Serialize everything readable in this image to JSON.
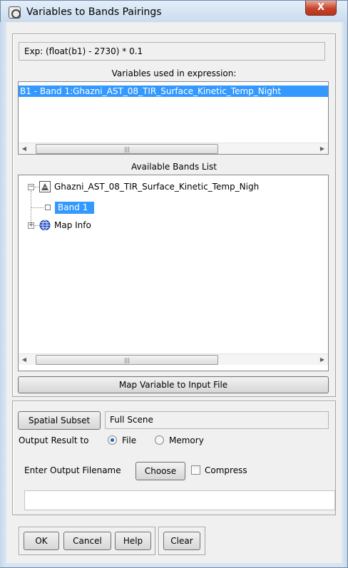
{
  "window": {
    "title": "Variables to Bands Pairings",
    "close_glyph": "X"
  },
  "expression": {
    "label": "Exp:",
    "value": "(float(b1) - 2730) * 0.1"
  },
  "variables": {
    "heading": "Variables used in expression:",
    "items": [
      "B1 - Band 1:Ghazni_AST_08_TIR_Surface_Kinetic_Temp_Night"
    ]
  },
  "bands": {
    "heading": "Available Bands List",
    "file_node": "Ghazni_AST_08_TIR_Surface_Kinetic_Temp_Nigh",
    "band_node": "Band 1",
    "mapinfo_node": "Map Info"
  },
  "map_button_label": "Map Variable to Input File",
  "spatial": {
    "button_label": "Spatial Subset",
    "value": "Full Scene"
  },
  "output": {
    "label": "Output Result to",
    "file_label": "File",
    "memory_label": "Memory",
    "selected": "File"
  },
  "filename": {
    "label": "Enter Output Filename",
    "choose_label": "Choose",
    "compress_label": "Compress",
    "value": ""
  },
  "footer": {
    "ok": "OK",
    "cancel": "Cancel",
    "help": "Help",
    "clear": "Clear"
  },
  "icons": {
    "scroll_left": "left-arrow-icon",
    "scroll_right": "right-arrow-icon",
    "scroll_grip": "grip-icon",
    "raster": "raster-file-icon",
    "globe": "globe-icon"
  },
  "colors": {
    "selection": "#3399ff",
    "window_frame": "#d7e4f2",
    "close_button": "#c7432a"
  }
}
